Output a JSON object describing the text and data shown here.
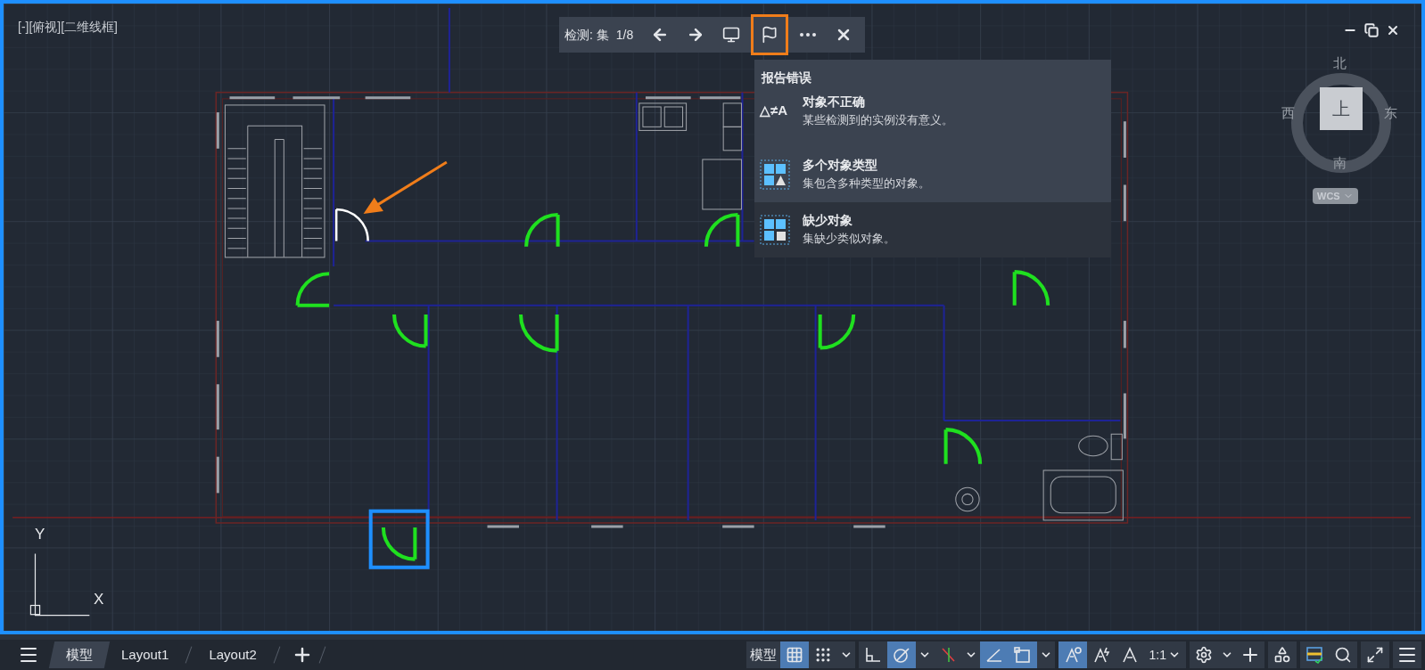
{
  "viewport": {
    "label": "[-][俯视][二维线框]"
  },
  "detection_toolbar": {
    "label": "检测: 集",
    "counter": "1/8",
    "buttons": [
      {
        "kind": "previous",
        "selected": false
      },
      {
        "kind": "next",
        "selected": false
      },
      {
        "kind": "zoom-to-object",
        "selected": false
      },
      {
        "kind": "report",
        "selected": true
      },
      {
        "kind": "more",
        "selected": false
      },
      {
        "kind": "close",
        "selected": false
      }
    ]
  },
  "report_menu": {
    "title": "报告错误",
    "items": [
      {
        "kind": "symbol",
        "symbol": "△≠A",
        "title": "对象不正确",
        "description": "某些检测到的实例没有意义。",
        "selected": true
      },
      {
        "kind": "multiple-types",
        "title": "多个对象类型",
        "description": "集包含多种类型的对象。",
        "selected": true
      },
      {
        "kind": "missing",
        "title": "缺少对象",
        "description": "集缺少类似对象。",
        "selected": false
      }
    ]
  },
  "viewcube": {
    "north": "北",
    "west": "西",
    "east": "东",
    "south": "南",
    "face": "上",
    "coordinate_system": "WCS"
  },
  "ucs": {
    "y": "Y",
    "x": "X"
  },
  "layout_tabs": [
    {
      "label": "模型",
      "selected": true
    },
    {
      "label": "Layout1",
      "selected": false
    },
    {
      "label": "Layout2",
      "selected": false
    }
  ],
  "status_bar": {
    "groups": [
      {
        "items": [
          {
            "kind": "model",
            "label": "模型",
            "on": false
          },
          {
            "kind": "grid",
            "on": true
          },
          {
            "kind": "snap",
            "on": false
          },
          {
            "kind": "dropdown",
            "on": false
          }
        ]
      },
      {
        "items": [
          {
            "kind": "ortho",
            "on": false
          },
          {
            "kind": "polar",
            "on": true
          },
          {
            "kind": "dropdown",
            "on": false
          },
          {
            "kind": "isodraft",
            "on": false
          },
          {
            "kind": "dropdown",
            "on": false
          },
          {
            "kind": "angle",
            "on": true
          },
          {
            "kind": "osnap",
            "on": true
          },
          {
            "kind": "dropdown",
            "on": false
          }
        ]
      },
      {
        "items": [
          {
            "kind": "annotation",
            "on": true
          },
          {
            "kind": "annotation-auto",
            "on": false
          },
          {
            "kind": "annotation-scale",
            "on": false
          },
          {
            "kind": "scale",
            "label": "1:1",
            "on": false
          }
        ]
      },
      {
        "items": [
          {
            "kind": "gear",
            "on": false
          },
          {
            "kind": "dropdown",
            "on": false
          },
          {
            "kind": "plus",
            "on": false
          }
        ]
      },
      {
        "items": [
          {
            "kind": "shapes",
            "on": false
          }
        ]
      },
      {
        "items": [
          {
            "kind": "isolate",
            "on": false
          },
          {
            "kind": "inspect",
            "on": false
          }
        ]
      },
      {
        "items": [
          {
            "kind": "fullscreen",
            "on": false
          }
        ]
      },
      {
        "items": [
          {
            "kind": "menu",
            "on": false
          }
        ]
      }
    ]
  }
}
